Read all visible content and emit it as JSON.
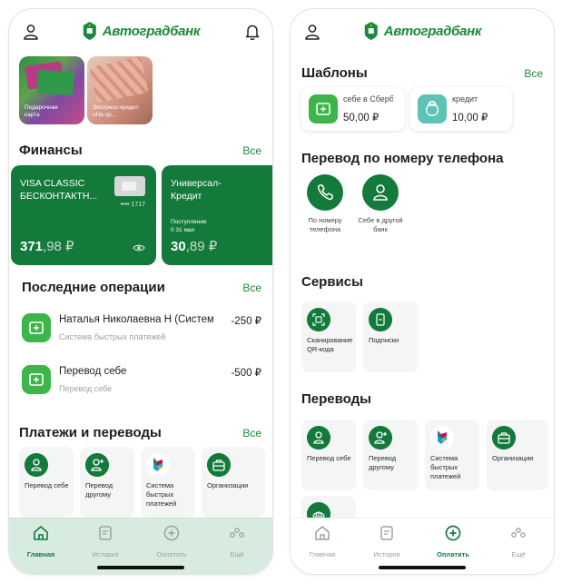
{
  "brand": {
    "name": "Автоградбанк",
    "color": "#1a8a3a",
    "card_color": "#147a3c",
    "accent_light": "#3cb54a"
  },
  "left": {
    "promos": [
      {
        "label": "Подарочная карта"
      },
      {
        "label": "Экспресс-кредит «На ср..."
      }
    ],
    "finance": {
      "title": "Финансы",
      "all": "Все",
      "cards": [
        {
          "name": "VISA CLASSIC БЕСКОНТАКТН...",
          "number": "•••• 1717",
          "balance_int": "371",
          "balance_frac": ",98 ₽"
        },
        {
          "name": "Универсал-Кредит",
          "sub_label": "Поступление",
          "sub_date": "0 31 мая",
          "balance_int": "30",
          "balance_frac": ",89 ₽"
        }
      ]
    },
    "operations": {
      "title": "Последние операции",
      "all": "Все",
      "items": [
        {
          "title": "Наталья Николаевна Н (Система",
          "sub": "Система быстрых платежей",
          "amount": "-250 ₽"
        },
        {
          "title": "Перевод себе",
          "sub": "Перевод себе",
          "amount": "-500 ₽"
        }
      ]
    },
    "payments": {
      "title": "Платежи и переводы",
      "all": "Все",
      "tiles": [
        {
          "label": "Перевод себе"
        },
        {
          "label": "Перевод другому"
        },
        {
          "label": "Система быстрых платежей"
        },
        {
          "label": "Организации"
        }
      ]
    }
  },
  "right": {
    "templates": {
      "title": "Шаблоны",
      "all": "Все",
      "items": [
        {
          "title": "себе в Сбербанк",
          "value": "50,00 ₽",
          "color": "#3cb54a"
        },
        {
          "title": "кредит",
          "value": "10,00 ₽",
          "color": "#5cc3b6"
        }
      ]
    },
    "phone_transfer": {
      "title": "Перевод по номеру телефона",
      "items": [
        {
          "label": "По номеру телефона"
        },
        {
          "label": "Себе в другой банк"
        }
      ]
    },
    "services": {
      "title": "Сервисы",
      "tiles": [
        {
          "label": "Сканирование QR-кода"
        },
        {
          "label": "Подписки"
        }
      ]
    },
    "transfers": {
      "title": "Переводы",
      "tiles": [
        {
          "label": "Перевод себе"
        },
        {
          "label": "Перевод другому"
        },
        {
          "label": "Система быстрых платежей"
        },
        {
          "label": "Организации"
        }
      ]
    }
  },
  "tabs": [
    {
      "label": "Главная"
    },
    {
      "label": "История"
    },
    {
      "label": "Оплатить"
    },
    {
      "label": "Ещё"
    }
  ]
}
